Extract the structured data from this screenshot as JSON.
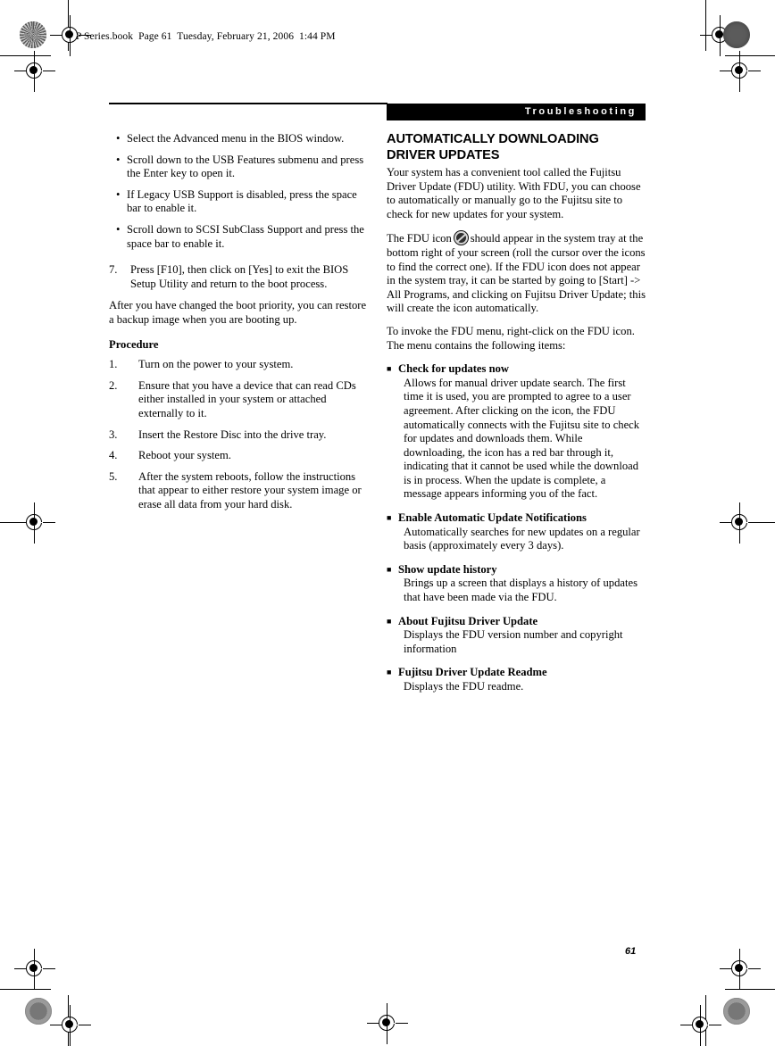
{
  "header": {
    "file_line": "P Series.book  Page 61  Tuesday, February 21, 2006  1:44 PM"
  },
  "running_head": {
    "chapter": "Troubleshooting"
  },
  "page_footer": {
    "page_number": "61"
  },
  "left_column": {
    "bullets": [
      {
        "bullet": "•",
        "text": "Select the Advanced menu in the BIOS window."
      },
      {
        "bullet": "•",
        "text": "Scroll down to the USB Features submenu and press the Enter key to open it."
      },
      {
        "bullet": "•",
        "text": "If Legacy USB Support is disabled, press the space bar to enable it."
      },
      {
        "bullet": "•",
        "text": "Scroll down to SCSI SubClass Support and press the space bar to enable it."
      }
    ],
    "step_seven": {
      "number": "7.",
      "text": "Press [F10], then click on [Yes] to exit the BIOS Setup Utility and return to the boot process."
    },
    "after_paragraph": "After you have changed the boot priority, you can restore a backup image when you are booting up.",
    "procedure_heading": "Procedure",
    "procedure_steps": [
      {
        "number": "1.",
        "text": "Turn on the power to your system."
      },
      {
        "number": "2.",
        "text": "Ensure that you have a device that can read CDs either installed in your system or attached externally to it."
      },
      {
        "number": "3.",
        "text": "Insert the Restore Disc into the drive tray."
      },
      {
        "number": "4.",
        "text": "Reboot your system."
      },
      {
        "number": "5.",
        "text": "After the system reboots, follow the instructions that appear to either restore your system image or erase all data from your hard disk."
      }
    ]
  },
  "right_column": {
    "section_title_line1": "AUTOMATICALLY DOWNLOADING",
    "section_title_line2": "DRIVER UPDATES",
    "paragraph_1": "Your system has a convenient tool called the Fujitsu Driver Update (FDU) utility. With FDU, you can choose to automatically or manually go to the Fujitsu site to check for new updates for your system.",
    "paragraph_2_part1": "The FDU icon",
    "paragraph_2_part2": "should appear in the system tray at the bottom right of your screen (roll the cursor over the icons to find the correct one). If the FDU icon does not appear in the system tray, it can be started by going to [Start] -> All Programs, and clicking on Fujitsu Driver Update; this will create the icon automatically.",
    "paragraph_3": "To invoke the FDU menu, right-click on the FDU icon. The menu contains the following items:",
    "menu_bullet_glyph": "■",
    "menu_items": [
      {
        "term": "Check for updates now",
        "definition": "Allows for manual driver update search. The first time it is used, you are prompted to agree to a user agreement. After clicking on the icon, the FDU automatically connects with the Fujitsu site to check for updates and downloads them. While downloading, the icon has a red bar through it, indicating that it cannot be used while the download is in process. When the update is complete, a message appears informing you of the fact."
      },
      {
        "term": "Enable Automatic Update Notifications",
        "definition": "Automatically searches for new updates on a regular basis (approximately every 3 days)."
      },
      {
        "term": "Show update history",
        "definition": "Brings up a screen that displays a history of updates that have been made via the FDU."
      },
      {
        "term": "About Fujitsu Driver Update",
        "definition": "Displays the FDU version number and copyright information"
      },
      {
        "term": "Fujitsu Driver Update Readme",
        "definition": "Displays the FDU readme."
      }
    ]
  }
}
